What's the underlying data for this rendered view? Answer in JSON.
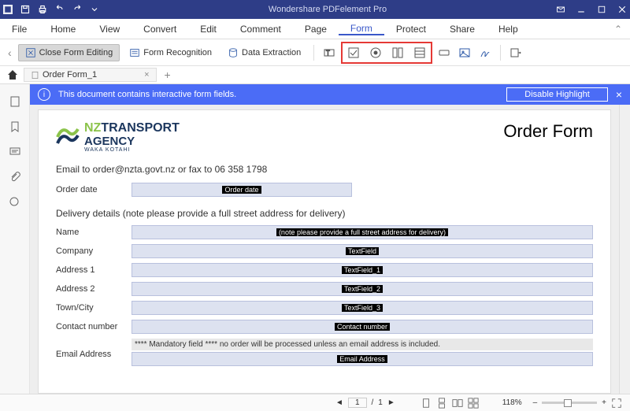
{
  "title": "Wondershare PDFelement Pro",
  "menu": [
    "File",
    "Home",
    "View",
    "Convert",
    "Edit",
    "Comment",
    "Page",
    "Form",
    "Protect",
    "Share",
    "Help"
  ],
  "activeMenu": "Form",
  "toolbar": {
    "closeFormEditing": "Close Form Editing",
    "formRecognition": "Form Recognition",
    "dataExtraction": "Data Extraction"
  },
  "tab": {
    "name": "Order Form_1"
  },
  "banner": {
    "msg": "This document contains interactive form fields.",
    "btn": "Disable Highlight"
  },
  "doc": {
    "logo": {
      "nz": "NZ",
      "transport": "TRANSPORT",
      "agency": "AGENCY",
      "sub": "WAKA KOTAHI"
    },
    "title": "Order Form",
    "emailLine": "Email to order@nzta.govt.nz or fax to 06 358 1798",
    "orderDate": {
      "label": "Order date",
      "ph": "Order date"
    },
    "section": "Delivery details (note please provide a full street address for delivery)",
    "fields": [
      {
        "label": "Name",
        "ph": "(note please provide a full street address for delivery)"
      },
      {
        "label": "Company",
        "ph": "TextField"
      },
      {
        "label": "Address 1",
        "ph": "TextField_1"
      },
      {
        "label": "Address 2",
        "ph": "TextField_2"
      },
      {
        "label": "Town/City",
        "ph": "TextField_3"
      },
      {
        "label": "Contact number",
        "ph": "Contact number"
      }
    ],
    "mandatory": "**** Mandatory field **** no order will be processed unless an email address is included.",
    "email": {
      "label": "Email Address",
      "ph": "Email Address"
    }
  },
  "status": {
    "page": "1",
    "pageSep": "/",
    "total": "1",
    "zoom": "118%"
  }
}
